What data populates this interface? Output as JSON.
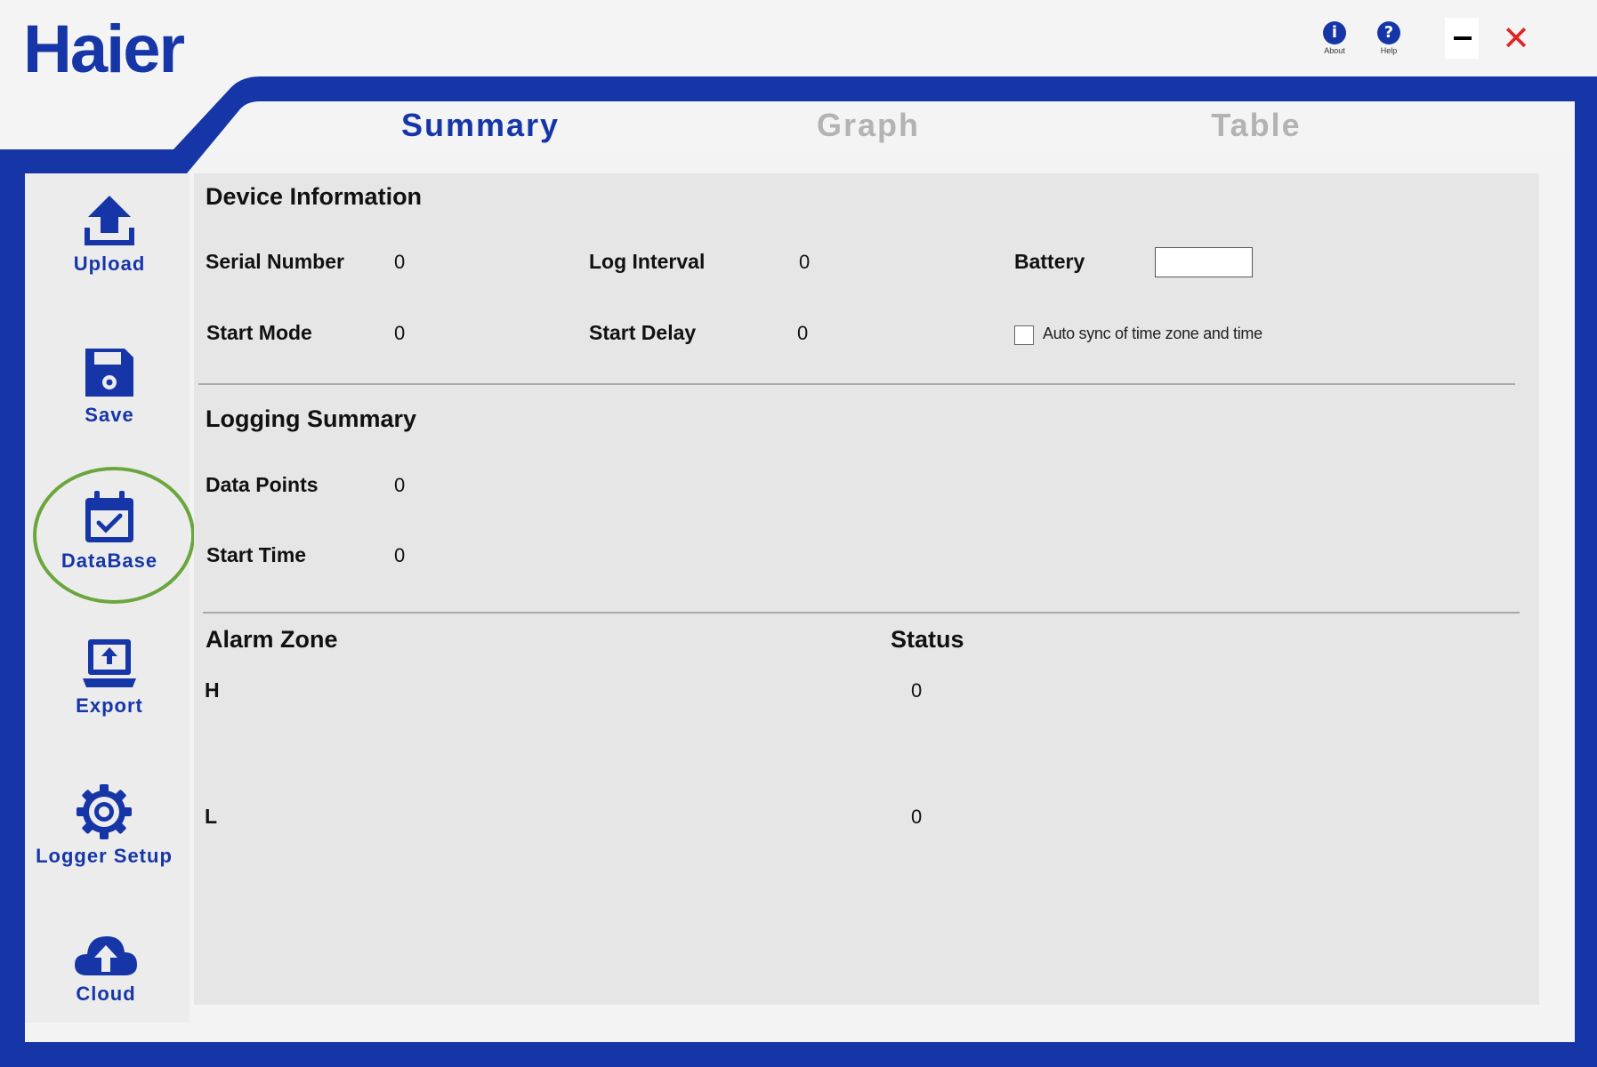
{
  "app": {
    "logo_text": "Haier",
    "about_label": "About",
    "help_label": "Help"
  },
  "tabs": [
    {
      "label": "Summary",
      "active": true
    },
    {
      "label": "Graph",
      "active": false
    },
    {
      "label": "Table",
      "active": false
    }
  ],
  "sidebar": {
    "items": [
      {
        "label": "Upload",
        "icon": "upload-icon"
      },
      {
        "label": "Save",
        "icon": "floppy-disk-icon"
      },
      {
        "label": "DataBase",
        "icon": "calendar-check-icon",
        "highlighted": true
      },
      {
        "label": "Export",
        "icon": "laptop-export-icon"
      },
      {
        "label": "Logger Setup",
        "icon": "gear-icon"
      },
      {
        "label": "Cloud",
        "icon": "cloud-upload-icon"
      }
    ]
  },
  "device_info": {
    "title": "Device Information",
    "serial_number_label": "Serial Number",
    "serial_number_value": "0",
    "log_interval_label": "Log Interval",
    "log_interval_value": "0",
    "battery_label": "Battery",
    "start_mode_label": "Start Mode",
    "start_mode_value": "0",
    "start_delay_label": "Start Delay",
    "start_delay_value": "0",
    "auto_sync_label": "Auto sync of time zone and time",
    "auto_sync_checked": false
  },
  "logging_summary": {
    "title": "Logging Summary",
    "data_points_label": "Data Points",
    "data_points_value": "0",
    "start_time_label": "Start Time",
    "start_time_value": "0"
  },
  "alarm": {
    "zone_title": "Alarm Zone",
    "status_title": "Status",
    "rows": [
      {
        "zone": "H",
        "status": "0"
      },
      {
        "zone": "L",
        "status": "0"
      }
    ]
  },
  "colors": {
    "brand_blue": "#1636a8",
    "highlight_ring": "#6aa63d",
    "close_red": "#e32222"
  }
}
